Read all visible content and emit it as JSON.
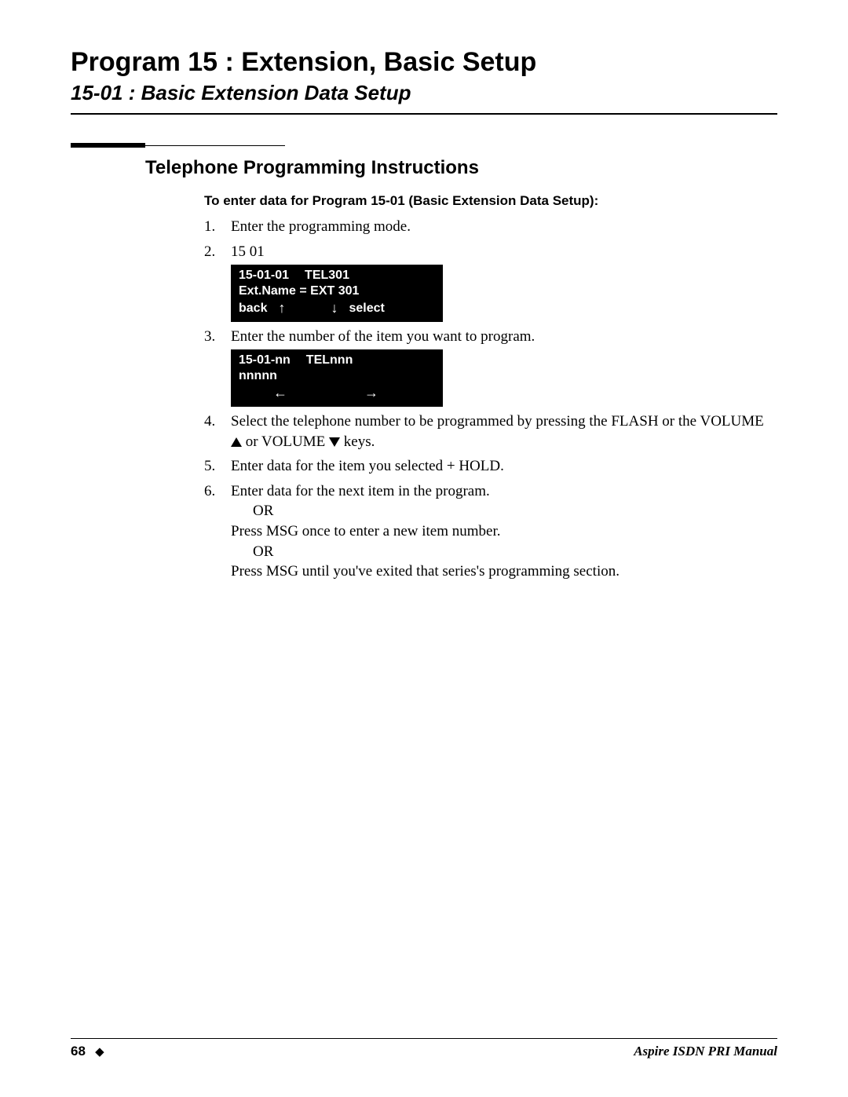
{
  "header": {
    "title": "Program 15 : Extension, Basic Setup",
    "subtitle": "15-01 : Basic Extension Data Setup"
  },
  "section": {
    "title": "Telephone Programming Instructions",
    "intro": "To enter data for Program 15-01 (Basic Extension Data Setup):"
  },
  "steps": {
    "s1": {
      "num": "1.",
      "text": "Enter the programming mode."
    },
    "s2": {
      "num": "2.",
      "text": "15 01"
    },
    "lcd1": {
      "line1_left": "15-01-01",
      "line1_right": "TEL301",
      "line2": "Ext.Name  = EXT 301",
      "back": "back",
      "select": "select"
    },
    "s3": {
      "num": "3.",
      "text": "Enter the number of the item you want to program."
    },
    "lcd2": {
      "line1_left": "15-01-nn",
      "line1_right": "TELnnn",
      "line2": "nnnnn"
    },
    "s4": {
      "num": "4.",
      "text_a": "Select the telephone number to be programmed by pressing the FLASH or the VOLUME ",
      "text_b": " or VOLUME ",
      "text_c": " keys."
    },
    "s5": {
      "num": "5.",
      "text": "Enter data for the item you selected + HOLD."
    },
    "s6": {
      "num": "6.",
      "line1": "Enter data for the next item in the program.",
      "or": "OR",
      "line2": "Press MSG once to enter a new item number.",
      "line3": "Press MSG until you've exited that series's programming section."
    }
  },
  "footer": {
    "page": "68",
    "manual": "Aspire ISDN PRI Manual"
  }
}
